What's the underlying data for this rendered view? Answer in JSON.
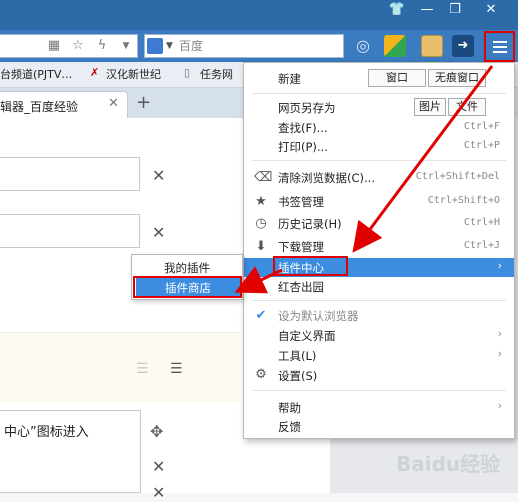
{
  "window": {
    "buttons": [
      "👕",
      "—",
      "❐",
      "✕"
    ]
  },
  "toolbar": {
    "search_placeholder": "百度",
    "icons": [
      "qr-icon",
      "star-icon",
      "bolt-icon",
      "dropdown-icon"
    ]
  },
  "bookmarks": [
    {
      "label": "台频道(PJTV…",
      "icon": ""
    },
    {
      "label": "汉化新世纪",
      "icon": "hanhua-icon"
    },
    {
      "label": "任务网",
      "icon": "page-icon"
    }
  ],
  "tab": {
    "title": "辑器_百度经验",
    "close": "✕",
    "new": "+"
  },
  "content": {
    "textbox_text": "中心”图标进入",
    "watermark": "Baidu经验"
  },
  "menu": {
    "new_label": "新建",
    "new_window": "窗口",
    "new_incognito": "无痕窗口",
    "save_as": "网页另存为",
    "save_image": "图片",
    "save_file": "文件",
    "find": "查找(F)...",
    "find_shortcut": "Ctrl+F",
    "print": "打印(P)...",
    "print_shortcut": "Ctrl+P",
    "clear": "清除浏览数据(C)...",
    "clear_shortcut": "Ctrl+Shift+Del",
    "bookmarks": "书签管理",
    "bookmarks_shortcut": "Ctrl+Shift+O",
    "history": "历史记录(H)",
    "history_shortcut": "Ctrl+H",
    "downloads": "下载管理",
    "downloads_shortcut": "Ctrl+J",
    "plugins": "插件中心",
    "redapricot": "红杏出园",
    "default_browser": "设为默认浏览器",
    "customize": "自定义界面",
    "tools": "工具(L)",
    "settings": "设置(S)",
    "help": "帮助",
    "feedback": "反馈"
  },
  "submenu": {
    "my_plugins": "我的插件",
    "plugin_store": "插件商店"
  },
  "colors": {
    "titlebar": "#2c6ba8",
    "highlight": "#3c8ce0",
    "annotation": "#e10000"
  }
}
